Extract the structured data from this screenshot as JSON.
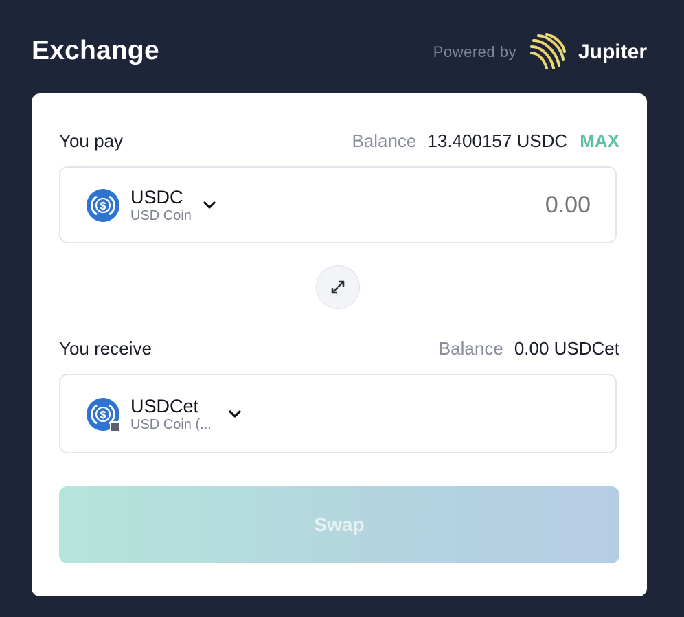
{
  "header": {
    "title": "Exchange",
    "powered_by": "Powered by",
    "brand": "Jupiter",
    "logo_icon": "jupiter-logo-icon"
  },
  "pay": {
    "label": "You pay",
    "balance_label": "Balance",
    "balance_value": "13.400157 USDC",
    "max_label": "MAX",
    "token": {
      "symbol": "USDC",
      "name": "USD Coin",
      "icon": "usdc-coin-icon"
    },
    "amount_placeholder": "0.00"
  },
  "receive": {
    "label": "You receive",
    "balance_label": "Balance",
    "balance_value": "0.00 USDCet",
    "token": {
      "symbol": "USDCet",
      "name": "USD Coin (...",
      "icon": "usdc-coin-icon"
    }
  },
  "swap_button": {
    "label": "Swap",
    "disabled": true
  },
  "colors": {
    "background": "#1f2538",
    "card": "#ffffff",
    "accent_max": "#5cc0a2",
    "usdc_blue": "#2f74d0"
  }
}
